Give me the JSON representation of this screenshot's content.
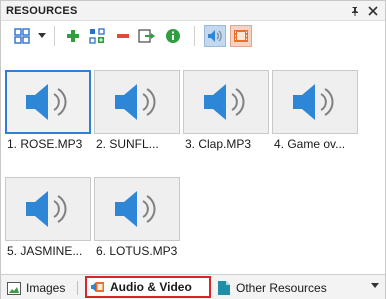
{
  "panel": {
    "title": "RESOURCES",
    "pin_icon": "pin-icon",
    "close_icon": "close-icon"
  },
  "toolbar": {
    "view_icon": "view-grid-icon",
    "dropdown_icon": "chevron-down-icon",
    "add_icon": "plus-icon",
    "import_icon": "import-icon",
    "remove_icon": "minus-icon",
    "export_icon": "export-icon",
    "info_icon": "info-icon",
    "audio_filter_icon": "speaker-icon",
    "video_filter_icon": "film-icon"
  },
  "items": [
    {
      "label": "1. ROSE.MP3",
      "icon": "speaker-icon",
      "selected": true
    },
    {
      "label": "2. SUNFL...",
      "icon": "speaker-icon",
      "selected": false
    },
    {
      "label": "3. Clap.MP3",
      "icon": "speaker-icon",
      "selected": false
    },
    {
      "label": "4. Game ov...",
      "icon": "speaker-icon",
      "selected": false
    },
    {
      "label": "5. JASMINE...",
      "icon": "speaker-icon",
      "selected": false
    },
    {
      "label": "6. LOTUS.MP3",
      "icon": "speaker-icon",
      "selected": false
    }
  ],
  "tabs": [
    {
      "label": "Images",
      "icon": "image-icon",
      "active": false
    },
    {
      "label": "Audio & Video",
      "icon": "audio-video-icon",
      "active": true
    },
    {
      "label": "Other Resources",
      "icon": "document-icon",
      "active": false
    }
  ],
  "colors": {
    "accent_blue": "#2e7fd6",
    "speaker_blue": "#2e86d6",
    "active_tab_border": "#d7262b",
    "add_green": "#2e9e3e",
    "remove_red": "#e04a3a"
  }
}
